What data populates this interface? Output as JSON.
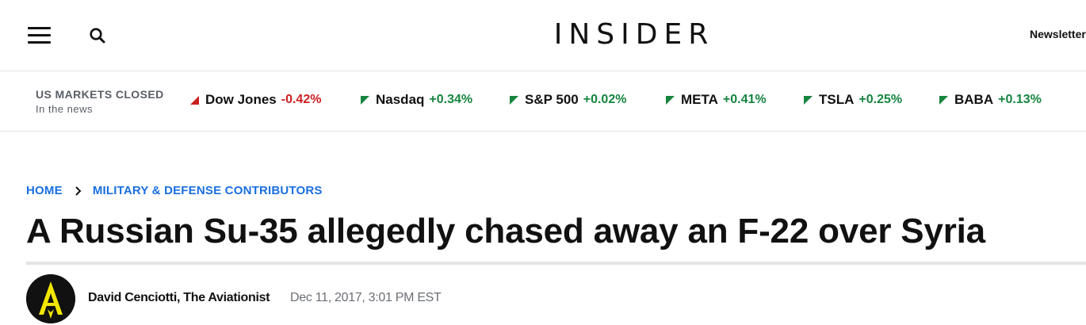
{
  "header": {
    "logo_text": "INSIDER",
    "newsletter_label": "Newsletters",
    "menu_icon": "hamburger-menu-icon",
    "search_icon": "search-icon"
  },
  "markets": {
    "status": "US MARKETS CLOSED",
    "subtitle": "In the news",
    "tickers": [
      {
        "name": "Dow Jones",
        "change": "-0.42%",
        "direction": "down",
        "color": "#cc1f1f"
      },
      {
        "name": "Nasdaq",
        "change": "+0.34%",
        "direction": "up",
        "color": "#16843f"
      },
      {
        "name": "S&P 500",
        "change": "+0.02%",
        "direction": "up",
        "color": "#16843f"
      },
      {
        "name": "META",
        "change": "+0.41%",
        "direction": "up",
        "color": "#16843f"
      },
      {
        "name": "TSLA",
        "change": "+0.25%",
        "direction": "up",
        "color": "#16843f"
      },
      {
        "name": "BABA",
        "change": "+0.13%",
        "direction": "up",
        "color": "#16843f"
      }
    ]
  },
  "breadcrumb": {
    "home": "HOME",
    "section": "MILITARY & DEFENSE CONTRIBUTORS",
    "separator_icon": "chevron-right-icon"
  },
  "article": {
    "headline": "A Russian Su-35 allegedly chased away an F-22 over Syria",
    "author": "David Cenciotti, The Aviationist",
    "date": "Dec 11, 2017, 3:01 PM EST"
  },
  "colors": {
    "link": "#1a6fe0",
    "negative": "#cc1f1f",
    "positive": "#16843f"
  }
}
